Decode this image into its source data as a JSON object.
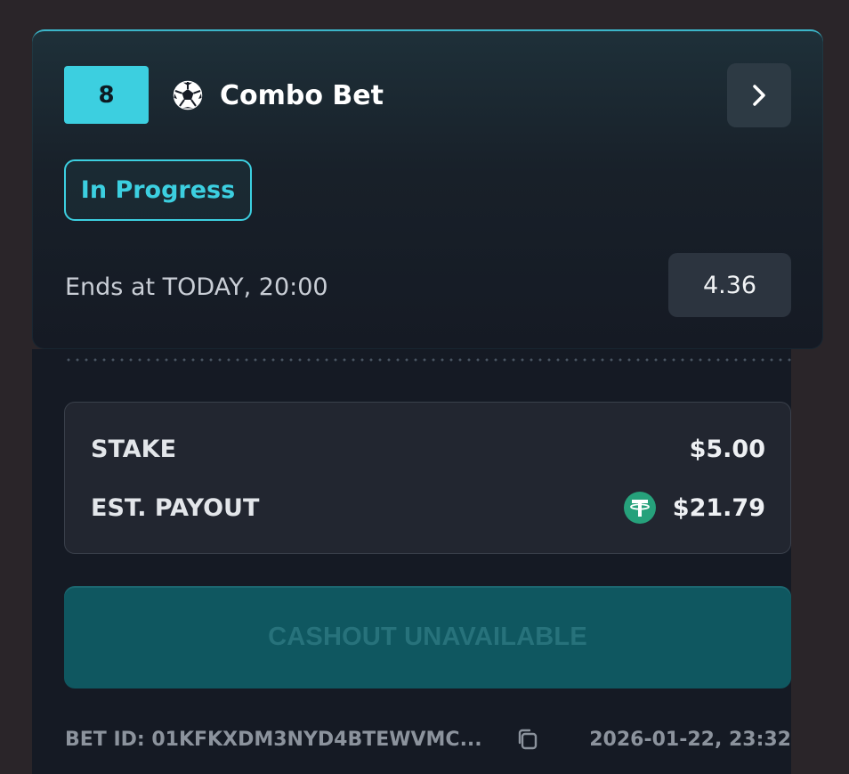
{
  "bet": {
    "legs_count": "8",
    "sport_icon": "soccer-ball-icon",
    "title": "Combo Bet",
    "status": "In Progress",
    "ends_text": "Ends at TODAY, 20:00",
    "odds": "4.36"
  },
  "summary": {
    "stake_label": "STAKE",
    "stake_value": "$5.00",
    "payout_label": "EST. PAYOUT",
    "payout_currency_icon": "tether-icon",
    "payout_value": "$21.79"
  },
  "cashout": {
    "label": "CASHOUT UNAVAILABLE"
  },
  "footer": {
    "bet_id": "BET ID: 01KFKXDM3NYD4BTEWVMC...",
    "copy_icon": "copy-icon",
    "date": "2026-01-22, 23:32"
  },
  "colors": {
    "accent": "#3ccfe0",
    "background": "#151a24",
    "cashout_button": "#0f5760",
    "tether": "#26a17b"
  }
}
